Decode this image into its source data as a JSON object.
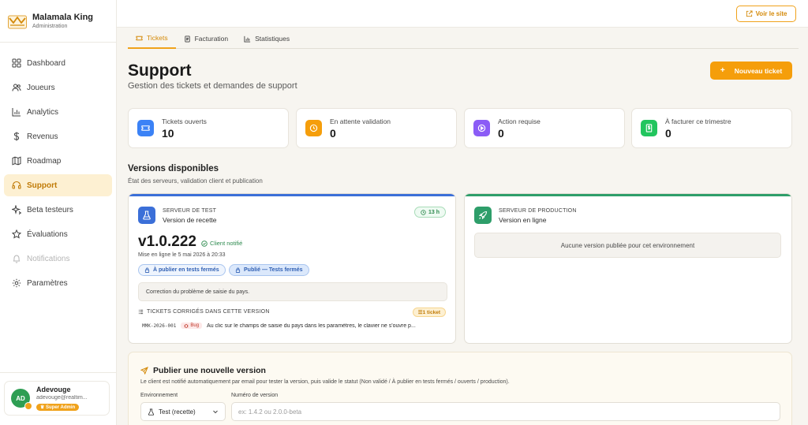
{
  "brand": {
    "name": "Malamala King",
    "subtitle": "Administration"
  },
  "topbar": {
    "site_button": "Voir le site"
  },
  "sidebar": {
    "items": [
      {
        "label": "Dashboard",
        "icon": "dashboard-icon"
      },
      {
        "label": "Joueurs",
        "icon": "users-icon"
      },
      {
        "label": "Analytics",
        "icon": "bar-chart-icon"
      },
      {
        "label": "Revenus",
        "icon": "dollar-icon"
      },
      {
        "label": "Roadmap",
        "icon": "map-icon"
      },
      {
        "label": "Support",
        "icon": "headset-icon",
        "active": true
      },
      {
        "label": "Beta testeurs",
        "icon": "sparkles-icon"
      },
      {
        "label": "Évaluations",
        "icon": "star-icon"
      },
      {
        "label": "Notifications",
        "icon": "bell-icon",
        "disabled": true
      },
      {
        "label": "Paramètres",
        "icon": "gear-icon"
      }
    ]
  },
  "user": {
    "initials": "AD",
    "name": "Adevouge",
    "email": "adevouge@realtim...",
    "role": "Super Admin"
  },
  "tabs": [
    {
      "label": "Tickets",
      "active": true
    },
    {
      "label": "Facturation"
    },
    {
      "label": "Statistiques"
    }
  ],
  "header": {
    "title": "Support",
    "subtitle": "Gestion des tickets et demandes de support",
    "new_ticket_button": "Nouveau ticket"
  },
  "stats": [
    {
      "label": "Tickets ouverts",
      "value": "10",
      "color": "#3b82f6"
    },
    {
      "label": "En attente validation",
      "value": "0",
      "color": "#f59e0b"
    },
    {
      "label": "Action requise",
      "value": "0",
      "color": "#8b5cf6"
    },
    {
      "label": "À facturer ce trimestre",
      "value": "0",
      "color": "#22c55e"
    }
  ],
  "versions": {
    "title": "Versions disponibles",
    "subtitle": "État des serveurs, validation client et publication",
    "test": {
      "label": "SERVEUR DE TEST",
      "name": "Version de recette",
      "age": "13 h",
      "version": "v1.0.222",
      "notified": "Client notifié",
      "online_date": "Mise en ligne le 5 mai 2026 à 20:33",
      "pill_1": "À publier en tests fermés",
      "pill_2": "Publié — Tests fermés",
      "note": "Correction du problème de saisie du pays.",
      "fixed_title": "TICKETS CORRIGÉS DANS CETTE VERSION",
      "fixed_count": "1 ticket",
      "tickets": [
        {
          "id": "MMK-2026-001",
          "tag": "Bug",
          "text": "Au clic sur le champs de saisie du pays dans les paramètres, le clavier ne s'ouvre p..."
        }
      ],
      "accent": "#3b6fd8"
    },
    "production": {
      "label": "SERVEUR DE PRODUCTION",
      "name": "Version en ligne",
      "empty": "Aucune version publiée pour cet environnement",
      "accent": "#2e9e6a"
    }
  },
  "publish": {
    "title": "Publier une nouvelle version",
    "description": "Le client est notifié automatiquement par email pour tester la version, puis valide le statut (Non validé / À publier en tests fermés / ouverts / production).",
    "env_label": "Environnement",
    "env_value": "Test (recette)",
    "version_label": "Numéro de version",
    "version_placeholder": "ex: 1.4.2 ou 2.0.0-beta"
  },
  "colors": {
    "accent": "#f59e0b",
    "active_bg": "#fdf0d2"
  }
}
